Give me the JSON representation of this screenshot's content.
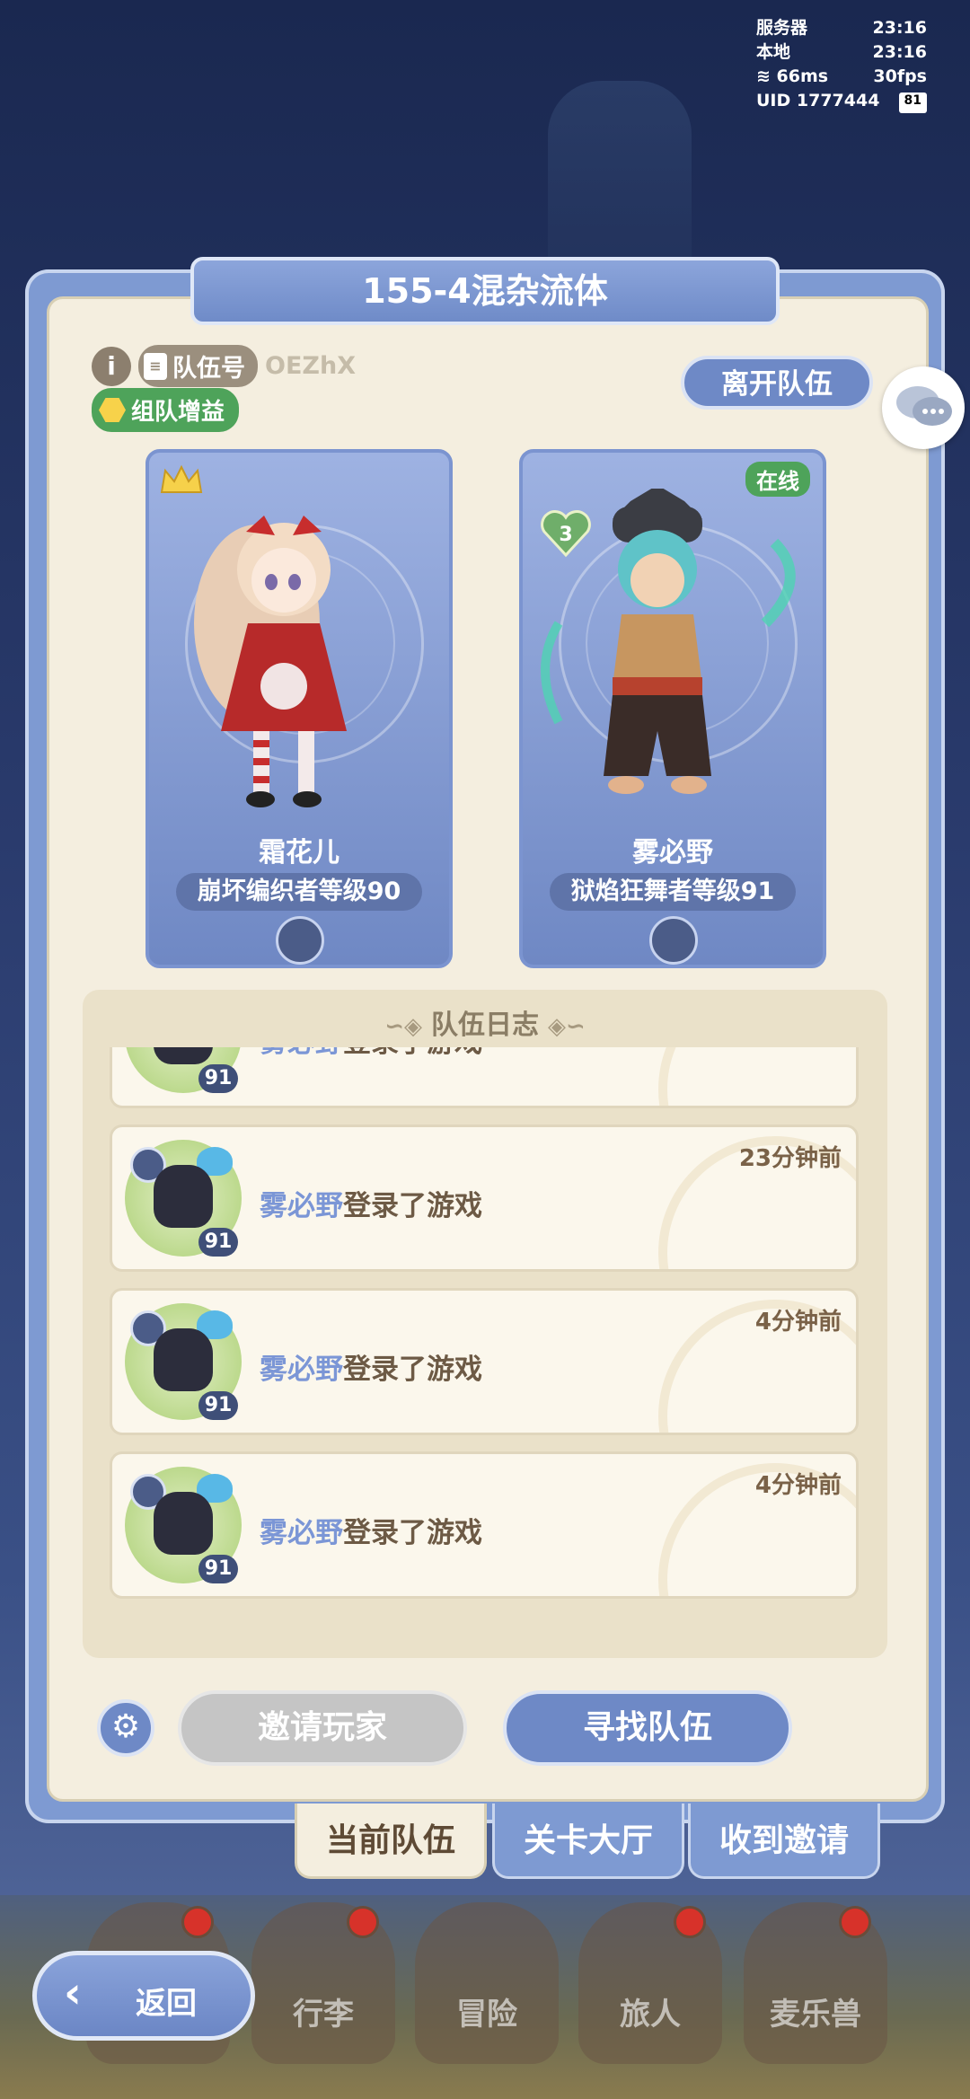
{
  "status": {
    "server_label": "服务器",
    "server_time": "23:16",
    "local_label": "本地",
    "local_time": "23:16",
    "ping": "66ms",
    "fps": "30fps",
    "uid": "UID 1777444",
    "battery": "81"
  },
  "panel": {
    "title": "155-4混杂流体",
    "info_icon": "i",
    "team_id_label": "队伍号",
    "team_code": "OEZhX",
    "buff_label": "组队增益",
    "leave_button": "离开队伍"
  },
  "members": [
    {
      "name": "霜花儿",
      "level_text": "崩坏编织者等级90",
      "is_leader": true
    },
    {
      "name": "雾必野",
      "level_text": "狱焰狂舞者等级91",
      "online_label": "在线",
      "friendship_level": "3"
    }
  ],
  "log": {
    "title": "队伍日志",
    "entries": [
      {
        "player": "雾必野",
        "action": "登录了游戏",
        "time": "",
        "level": "91"
      },
      {
        "player": "雾必野",
        "action": "登录了游戏",
        "time": "23分钟前",
        "level": "91"
      },
      {
        "player": "雾必野",
        "action": "登录了游戏",
        "time": "4分钟前",
        "level": "91"
      },
      {
        "player": "雾必野",
        "action": "登录了游戏",
        "time": "4分钟前",
        "level": "91"
      }
    ]
  },
  "actions": {
    "invite": "邀请玩家",
    "find": "寻找队伍"
  },
  "tabs": [
    "当前队伍",
    "关卡大厅",
    "收到邀请"
  ],
  "nav": [
    "行李",
    "冒险",
    "旅人",
    "麦乐兽"
  ],
  "back_label": "返回",
  "colors": {
    "accent_blue": "#6e89c6",
    "online_green": "#4ea35a",
    "player_name": "#7b96d6"
  }
}
